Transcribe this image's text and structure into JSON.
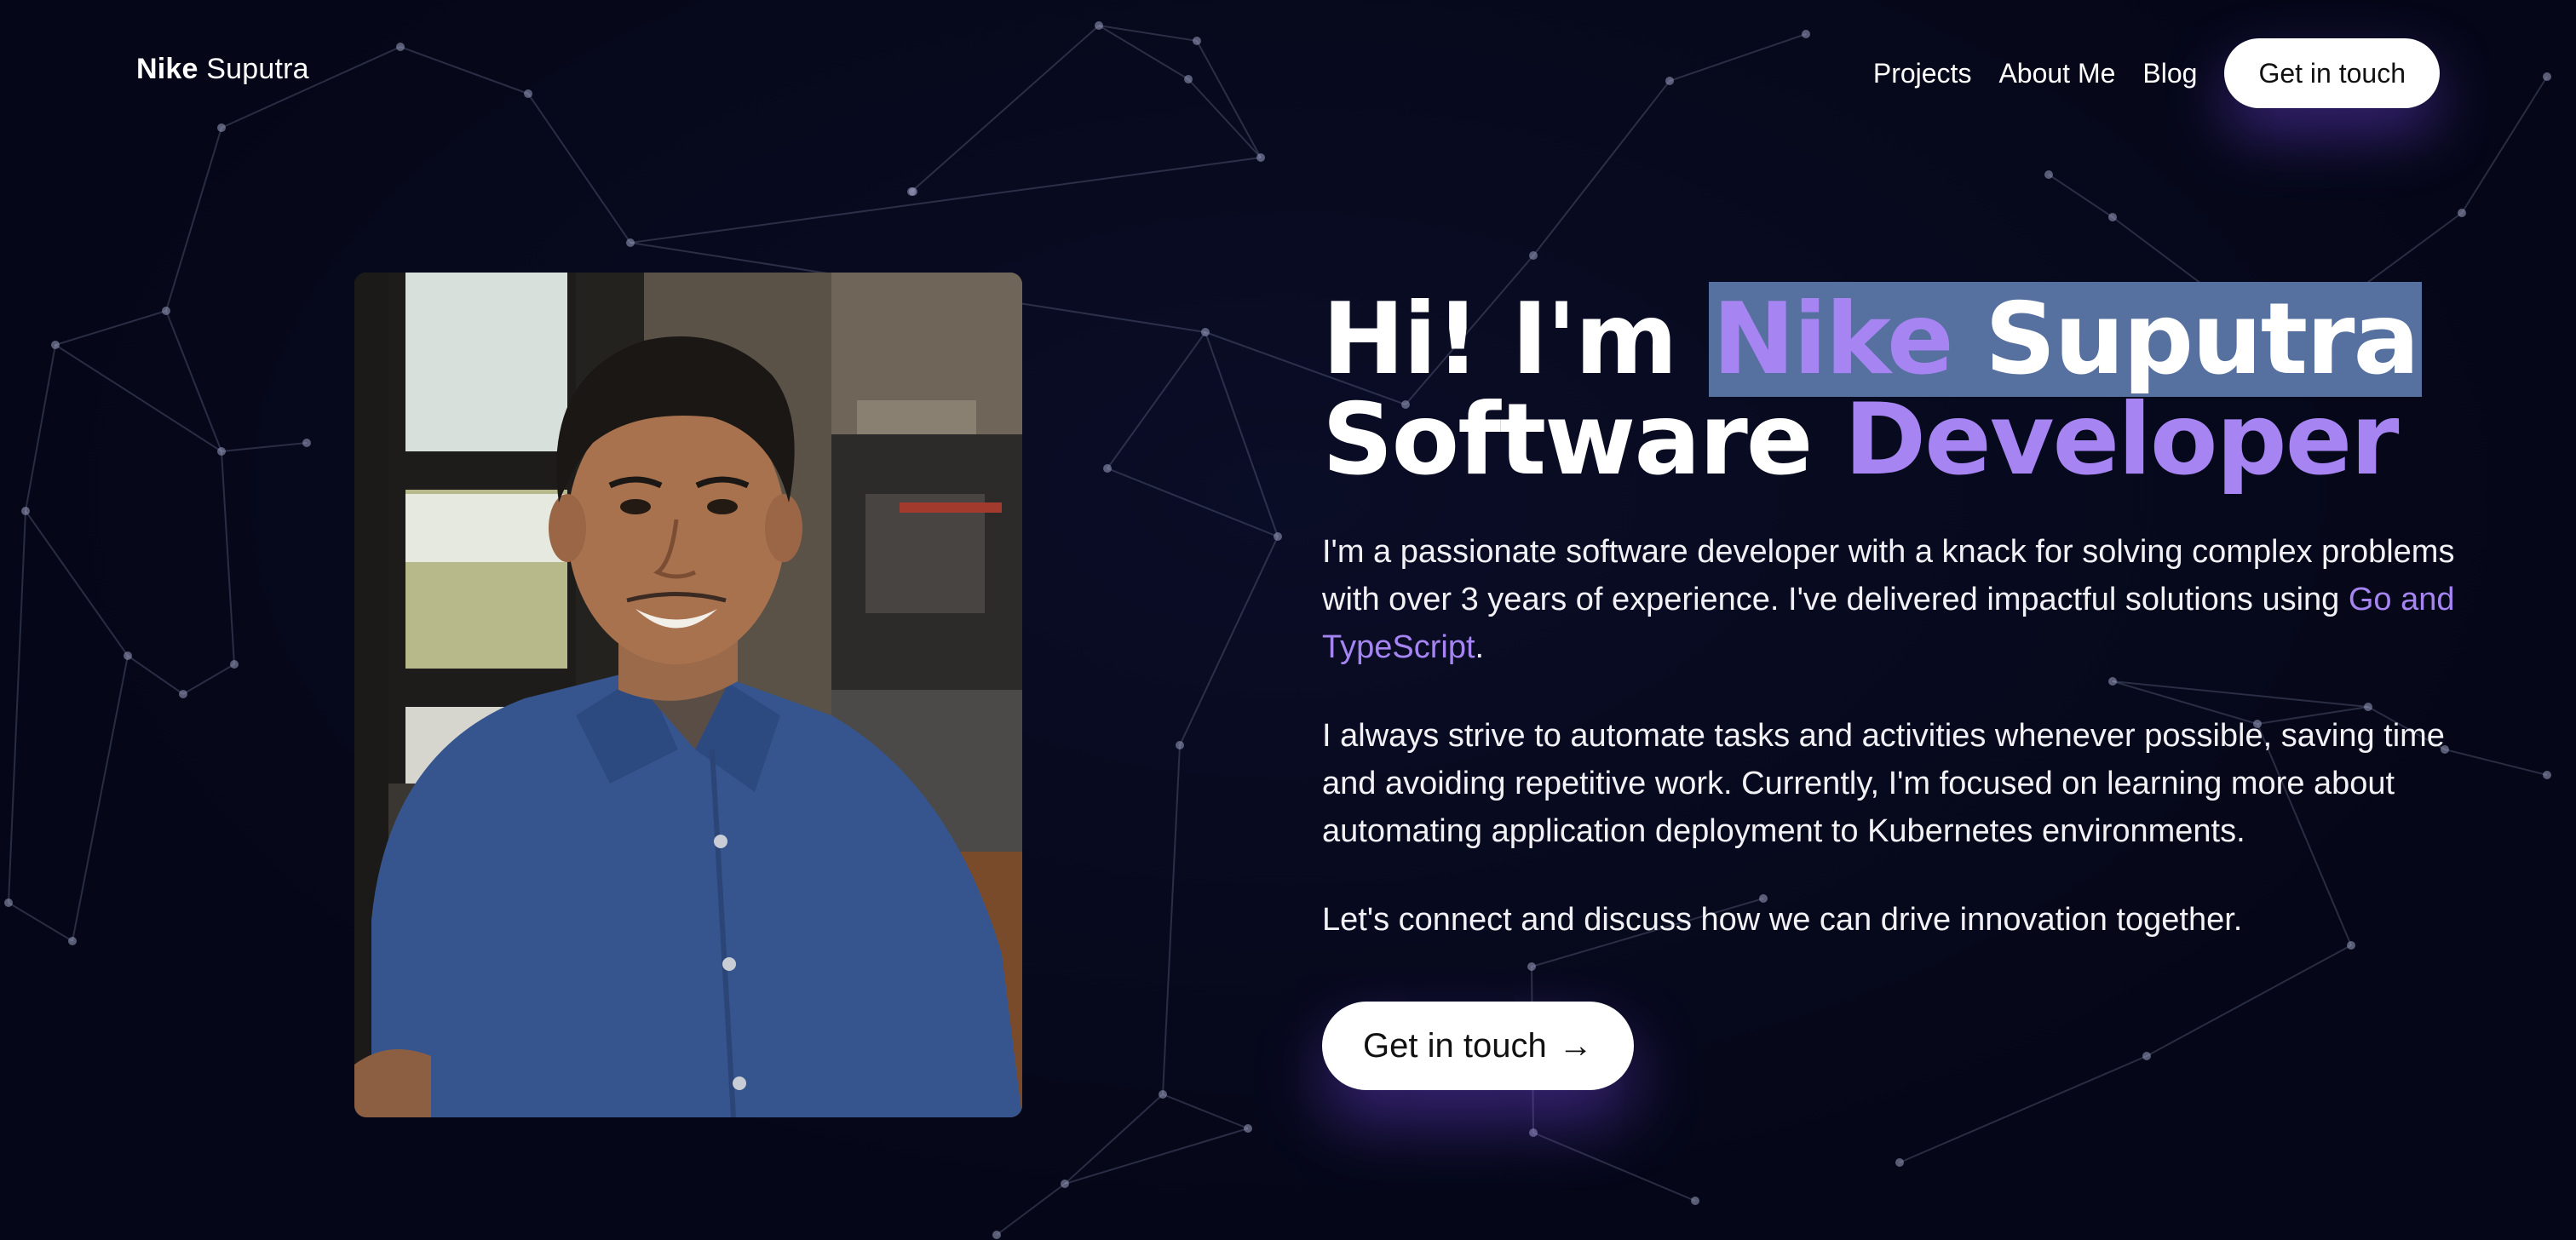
{
  "header": {
    "logo_first": "Nike",
    "logo_last": "Suputra",
    "nav": [
      {
        "label": "Projects"
      },
      {
        "label": "About Me"
      },
      {
        "label": "Blog"
      }
    ],
    "cta_label": "Get in touch"
  },
  "hero": {
    "greeting": "Hi! I'm",
    "name_first": "Nike",
    "name_last": "Suputra",
    "role_first": "Software",
    "role_second": "Developer",
    "p1_text": "I'm a passionate software developer with a knack for solving complex problems with over 3 years of experience. I've delivered impactful solutions using ",
    "p1_link": "Go and TypeScript",
    "p1_end": ".",
    "p2": "I always strive to automate tasks and activities whenever possible, saving time and avoiding repetitive work. Currently, I'm focused on learning more about automating application deployment to Kubernetes environments.",
    "p3": "Let's connect and discuss how we can drive innovation together.",
    "cta_label": "Get in touch",
    "cta_icon": "→"
  },
  "colors": {
    "background": "#050718",
    "accent": "#a685f2",
    "selection": "#56719f",
    "button_bg": "#ffffff"
  },
  "icons": {
    "cta_arrow": "arrow-right-icon"
  }
}
